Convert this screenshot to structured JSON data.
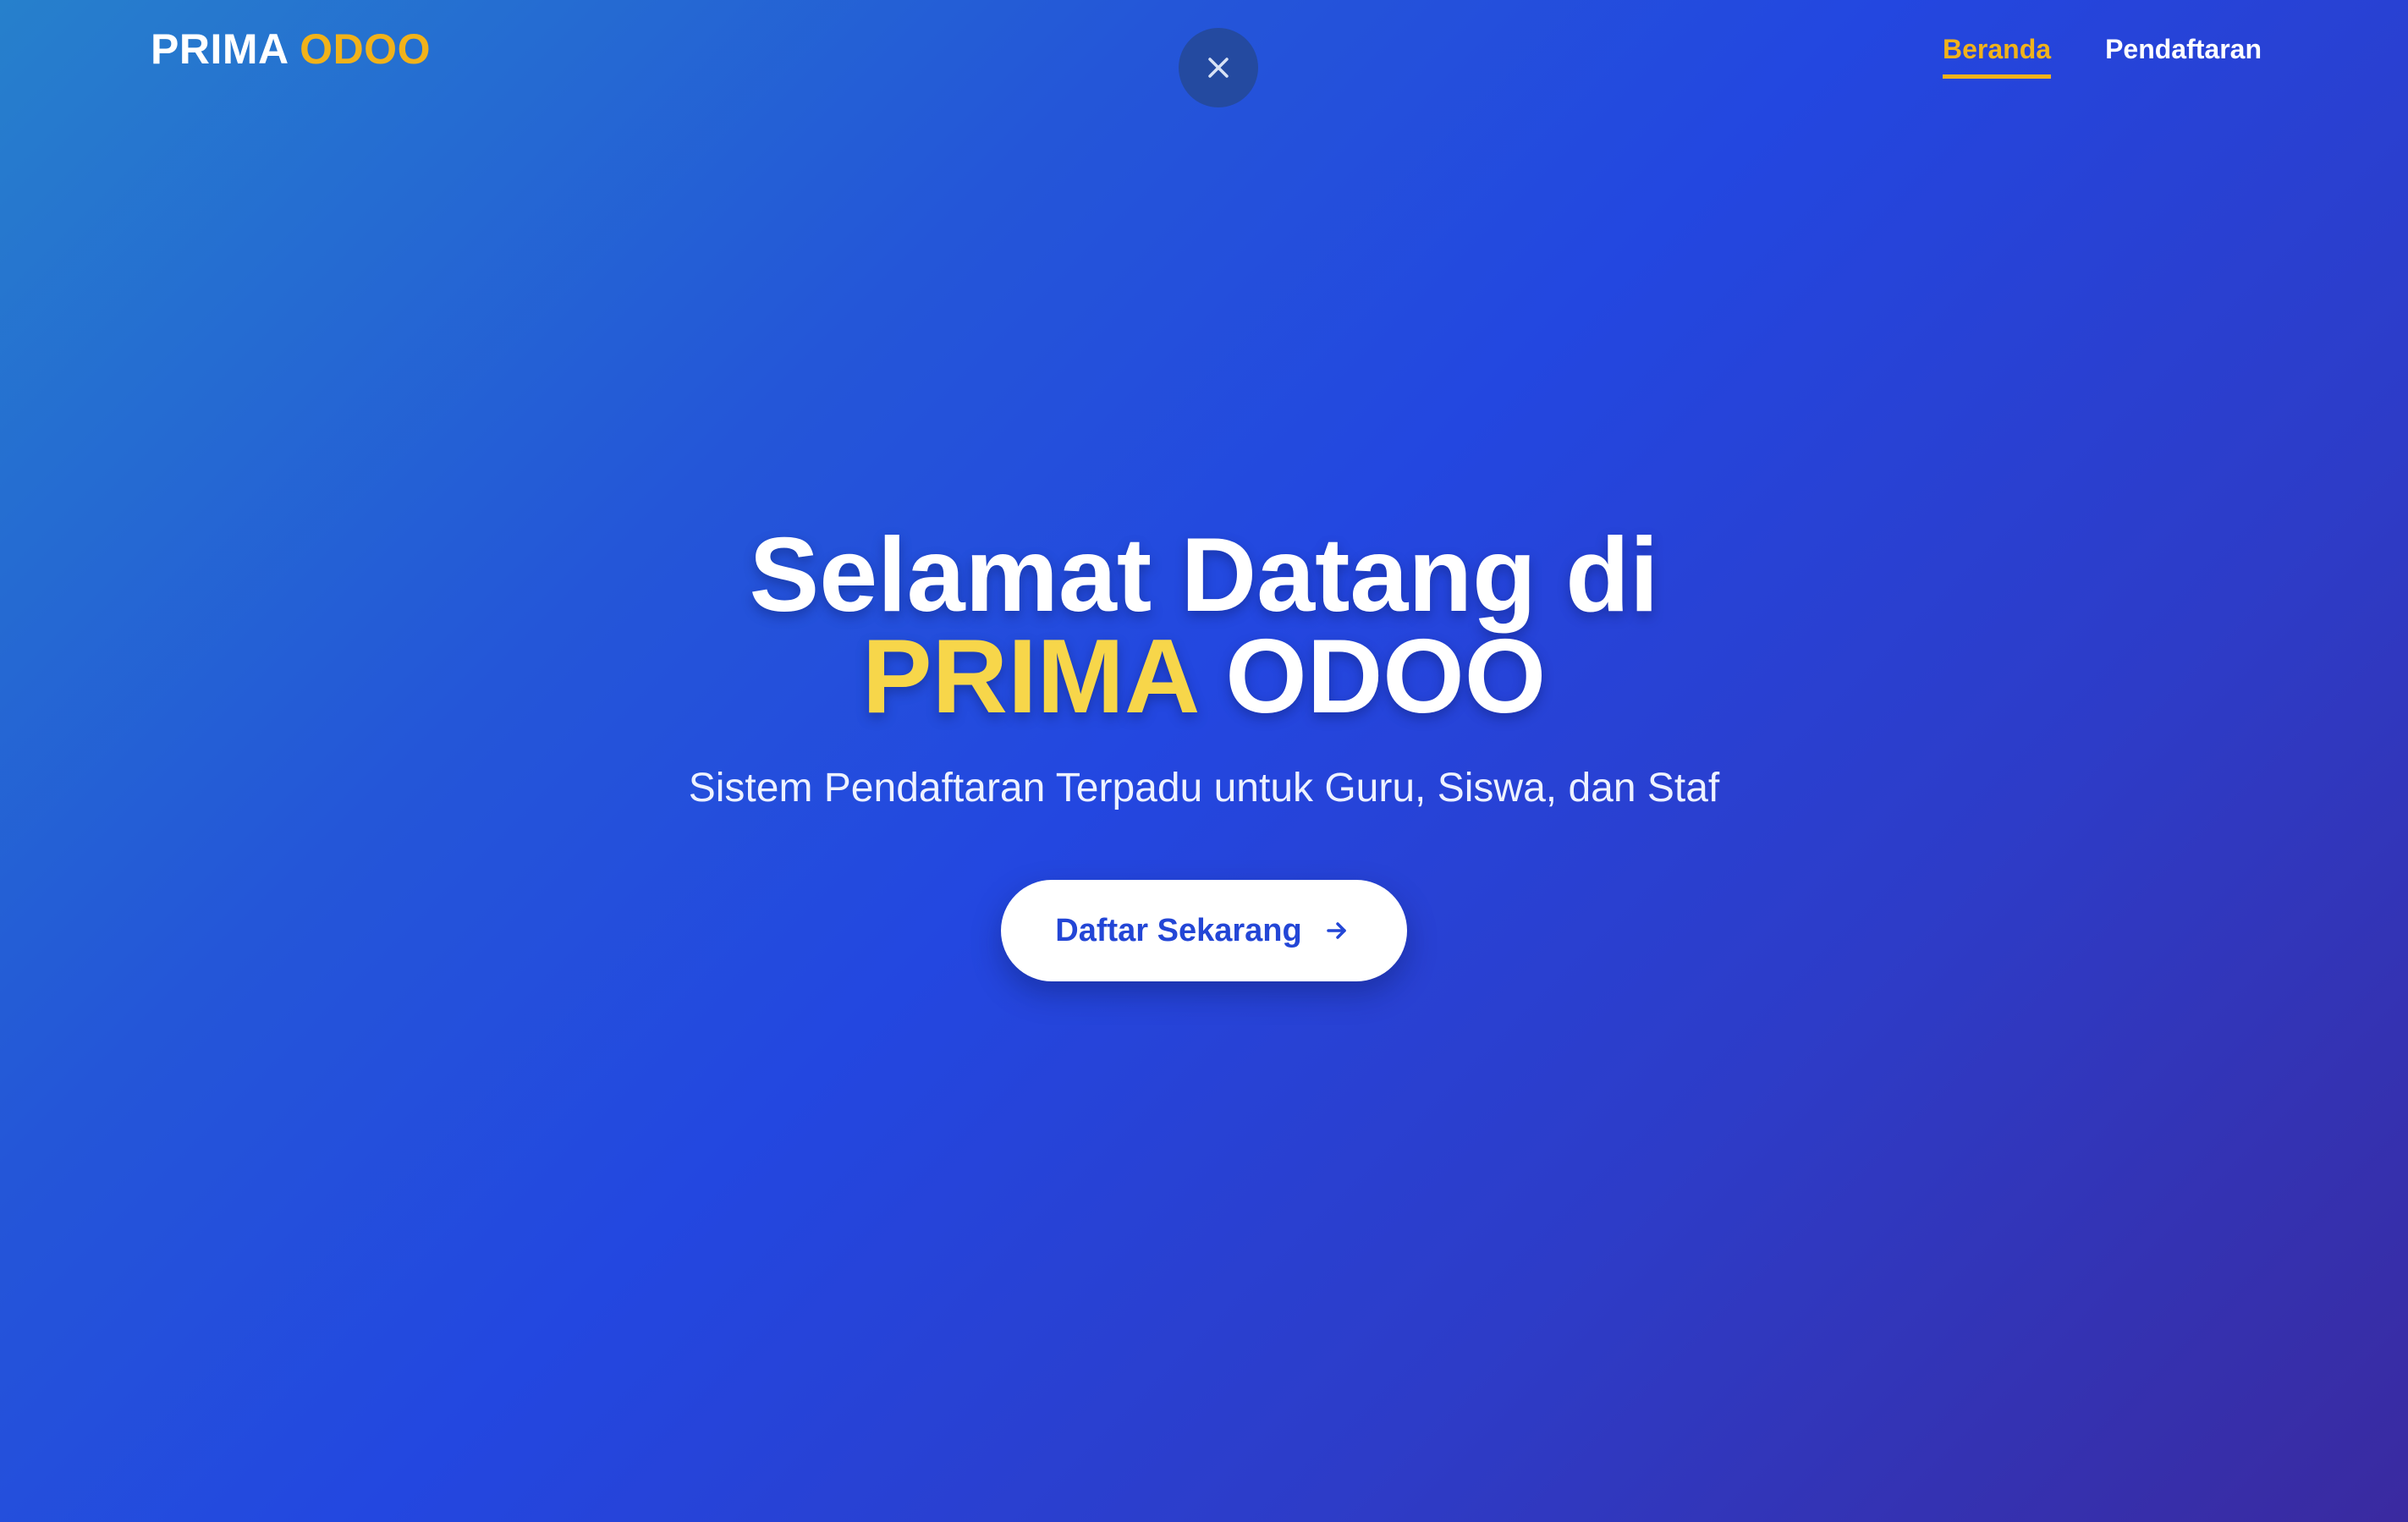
{
  "navbar": {
    "brand_primary": "PRIMA",
    "brand_accent": "ODOO",
    "close_icon": "close-icon",
    "links": [
      {
        "label": "Beranda",
        "active": true
      },
      {
        "label": "Pendaftaran",
        "active": false
      }
    ]
  },
  "hero": {
    "title_line1": "Selamat Datang di",
    "title_highlight": "PRIMA",
    "title_rest": "ODOO",
    "subtitle": "Sistem Pendaftaran Terpadu untuk Guru, Siswa, dan Staf",
    "cta_label": "Daftar Sekarang",
    "cta_icon": "arrow-right-icon"
  },
  "colors": {
    "accent_yellow": "#f1b21a",
    "highlight_yellow": "#f7d64a",
    "primary_blue": "#2346d6",
    "gradient_start": "#2680cc",
    "gradient_end": "#3a2aa0"
  }
}
